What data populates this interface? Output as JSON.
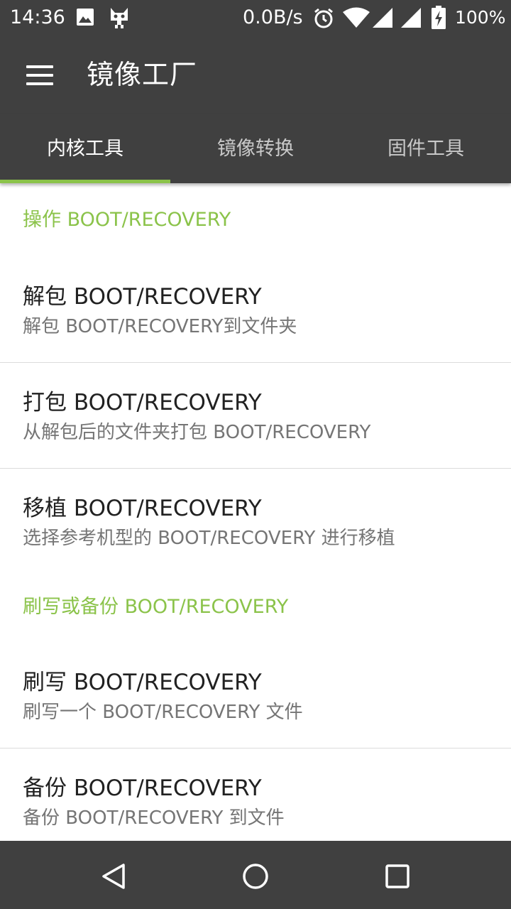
{
  "status_bar": {
    "time": "14:36",
    "net_speed": "0.0B/s",
    "battery": "100%",
    "icons": [
      "image-icon",
      "cat-icon",
      "alarm-icon",
      "wifi-icon",
      "signal-icon",
      "signal-icon",
      "battery-charging-icon"
    ]
  },
  "app_bar": {
    "title": "镜像工厂",
    "menu_icon": "hamburger-menu-icon"
  },
  "tabs": [
    {
      "label": "内核工具",
      "active": true
    },
    {
      "label": "镜像转换",
      "active": false
    },
    {
      "label": "固件工具",
      "active": false
    }
  ],
  "sections": [
    {
      "header": "操作 BOOT/RECOVERY",
      "items": [
        {
          "title": "解包 BOOT/RECOVERY",
          "subtitle": "解包 BOOT/RECOVERY到文件夹"
        },
        {
          "title": "打包 BOOT/RECOVERY",
          "subtitle": "从解包后的文件夹打包 BOOT/RECOVERY"
        },
        {
          "title": "移植 BOOT/RECOVERY",
          "subtitle": "选择参考机型的 BOOT/RECOVERY 进行移植"
        }
      ]
    },
    {
      "header": "刷写或备份 BOOT/RECOVERY",
      "items": [
        {
          "title": "刷写 BOOT/RECOVERY",
          "subtitle": "刷写一个 BOOT/RECOVERY 文件"
        },
        {
          "title": "备份 BOOT/RECOVERY",
          "subtitle": "备份 BOOT/RECOVERY 到文件"
        }
      ]
    }
  ],
  "nav_bar": {
    "icons": [
      "back-icon",
      "home-icon",
      "recents-icon"
    ]
  },
  "colors": {
    "bar_background": "#404040",
    "accent": "#8bc34a",
    "title_text": "#212121",
    "subtitle_text": "#757575"
  }
}
